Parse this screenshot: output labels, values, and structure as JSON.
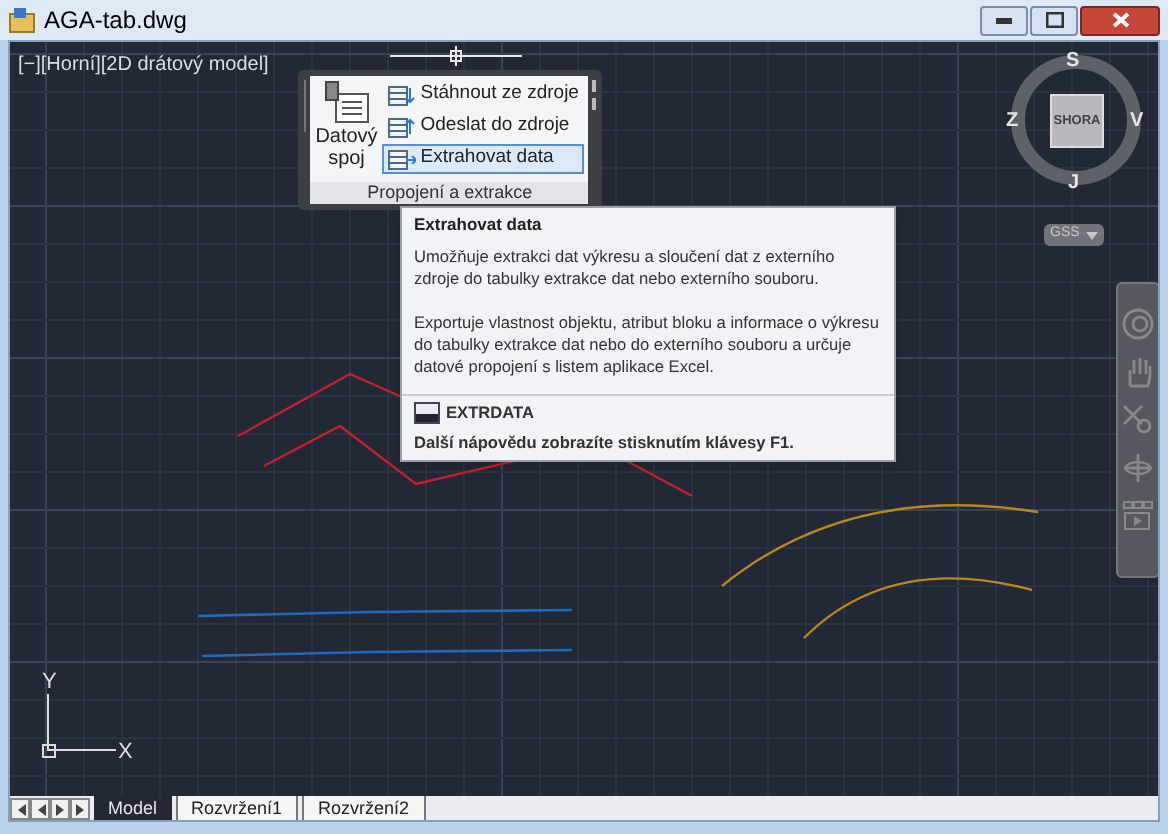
{
  "window": {
    "title": "AGA-tab.dwg"
  },
  "viewport": {
    "label": "[−][Horní][2D drátový model]"
  },
  "ribbon_panel": {
    "big_button": {
      "label": "Datový spoj"
    },
    "items": [
      {
        "label": "Stáhnout ze zdroje",
        "selected": false
      },
      {
        "label": "Odeslat do zdroje",
        "selected": false
      },
      {
        "label": "Extrahovat  data",
        "selected": true
      }
    ],
    "title": "Propojení a extrakce"
  },
  "tooltip": {
    "title": "Extrahovat  data",
    "paragraphs": [
      "Umožňuje extrakci dat výkresu a sloučení dat z externího zdroje do tabulky extrakce dat nebo externího souboru.",
      "Exportuje vlastnost objektu, atribut bloku a informace o výkresu do tabulky extrakce dat nebo do externího souboru a určuje datové propojení s listem aplikace Excel."
    ],
    "command": "EXTRDATA",
    "help": "Další nápovědu zobrazíte stisknutím klávesy F1."
  },
  "viewcube": {
    "north": "S",
    "east": "V",
    "south": "J",
    "west": "Z",
    "face": "SHORA",
    "ucs_menu": "GSS"
  },
  "ucs_icon": {
    "y": "Y",
    "x": "X"
  },
  "layout_tabs": [
    {
      "label": "Model",
      "selected": true
    },
    {
      "label": "Rozvržení1",
      "selected": false
    },
    {
      "label": "Rozvržení2",
      "selected": false
    }
  ]
}
